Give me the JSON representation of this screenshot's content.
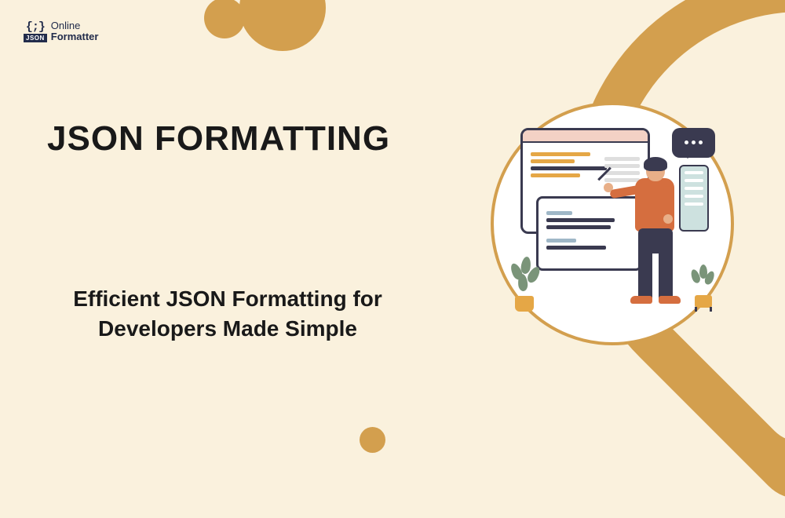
{
  "logo": {
    "brace": "{;}",
    "badge": "JSON",
    "line1": "Online",
    "line2": "Formatter"
  },
  "heading": "JSON FORMATTING",
  "subheading": "Efficient JSON Formatting for Developers Made Simple",
  "colors": {
    "background": "#faf1dd",
    "accent": "#d39f4e",
    "text": "#191919",
    "logo": "#222c4b"
  }
}
